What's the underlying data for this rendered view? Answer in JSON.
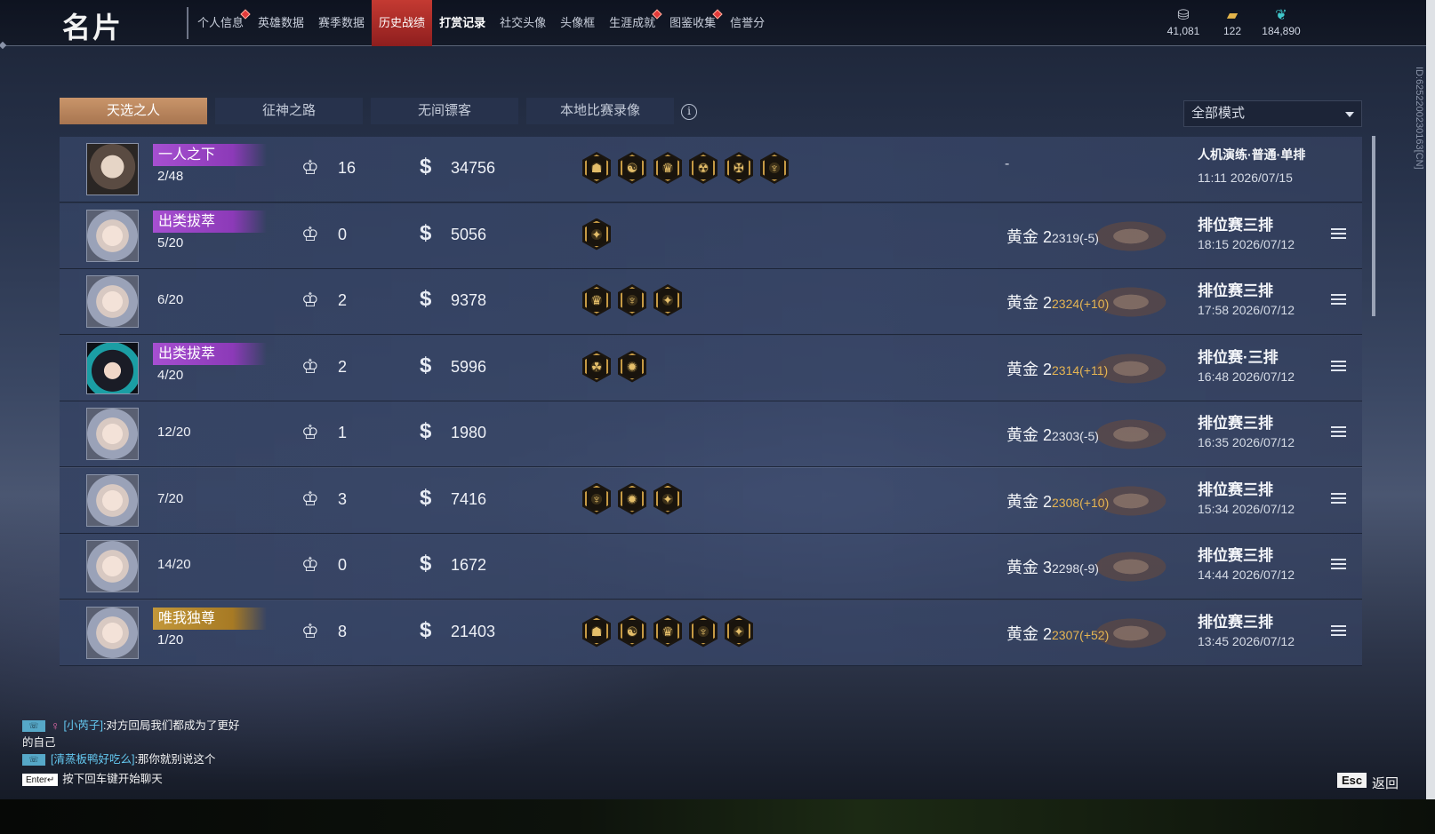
{
  "header": {
    "title": "名片",
    "nav": [
      {
        "label": "个人信息",
        "dot": true
      },
      {
        "label": "英雄数据",
        "dot": false
      },
      {
        "label": "赛季数据",
        "dot": false
      },
      {
        "label": "历史战绩",
        "dot": false,
        "active": true
      },
      {
        "label": "打赏记录",
        "dot": false,
        "bold": true
      },
      {
        "label": "社交头像",
        "dot": false
      },
      {
        "label": "头像框",
        "dot": false
      },
      {
        "label": "生涯成就",
        "dot": true
      },
      {
        "label": "图鉴收集",
        "dot": true
      },
      {
        "label": "信誉分",
        "dot": false
      }
    ],
    "currencies": [
      {
        "icon": "coin-stack-icon",
        "value": "41,081"
      },
      {
        "icon": "gold-ticket-icon",
        "value": "122"
      },
      {
        "icon": "feather-icon",
        "value": "184,890"
      }
    ]
  },
  "side_id": "ID:6252200230163[CN]",
  "mode_tabs": [
    "天选之人",
    "征神之路",
    "无间镖客",
    "本地比赛录像"
  ],
  "mode_select": "全部模式",
  "matches": [
    {
      "avatar": "a1",
      "badge": "一人之下",
      "badge_color": "purple",
      "rank": "2/48",
      "kills": "16",
      "score": "34756",
      "badges": [
        "☗",
        "☯",
        "♛",
        "☢",
        "✠",
        "♆"
      ],
      "tier_name": "",
      "tier_pts": "",
      "tier_dir": "",
      "dash": "-",
      "type": "人机演练·普通·单排",
      "time": "11:11  2026/07/15",
      "detail": false
    },
    {
      "avatar": "a2",
      "badge": "出类拔萃",
      "badge_color": "purple",
      "rank": "5/20",
      "kills": "0",
      "score": "5056",
      "badges": [
        "✦"
      ],
      "tier_name": "黄金 2",
      "tier_pts": "2319(-5)",
      "tier_dir": "down",
      "dash": "",
      "type": "排位赛三排",
      "time": "18:15  2026/07/12",
      "detail": true
    },
    {
      "avatar": "a2",
      "badge": "",
      "badge_color": "",
      "rank": "6/20",
      "kills": "2",
      "score": "9378",
      "badges": [
        "♛",
        "♆",
        "✦"
      ],
      "tier_name": "黄金 2",
      "tier_pts": "2324(+10)",
      "tier_dir": "up",
      "dash": "",
      "type": "排位赛三排",
      "time": "17:58  2026/07/12",
      "detail": true
    },
    {
      "avatar": "a3",
      "badge": "出类拔萃",
      "badge_color": "purple",
      "rank": "4/20",
      "kills": "2",
      "score": "5996",
      "badges": [
        "☘",
        "✹"
      ],
      "tier_name": "黄金 2",
      "tier_pts": "2314(+11)",
      "tier_dir": "up",
      "dash": "",
      "type": "排位赛·三排",
      "time": "16:48  2026/07/12",
      "detail": true
    },
    {
      "avatar": "a2",
      "badge": "",
      "badge_color": "",
      "rank": "12/20",
      "kills": "1",
      "score": "1980",
      "badges": [],
      "tier_name": "黄金 2",
      "tier_pts": "2303(-5)",
      "tier_dir": "down",
      "dash": "",
      "type": "排位赛三排",
      "time": "16:35  2026/07/12",
      "detail": true
    },
    {
      "avatar": "a2",
      "badge": "",
      "badge_color": "",
      "rank": "7/20",
      "kills": "3",
      "score": "7416",
      "badges": [
        "♆",
        "✹",
        "✦"
      ],
      "tier_name": "黄金 2",
      "tier_pts": "2308(+10)",
      "tier_dir": "up",
      "dash": "",
      "type": "排位赛三排",
      "time": "15:34  2026/07/12",
      "detail": true
    },
    {
      "avatar": "a2",
      "badge": "",
      "badge_color": "",
      "rank": "14/20",
      "kills": "0",
      "score": "1672",
      "badges": [],
      "tier_name": "黄金 3",
      "tier_pts": "2298(-9)",
      "tier_dir": "down",
      "dash": "",
      "type": "排位赛三排",
      "time": "14:44  2026/07/12",
      "detail": true
    },
    {
      "avatar": "a2",
      "badge": "唯我独尊",
      "badge_color": "gold",
      "rank": "1/20",
      "kills": "8",
      "score": "21403",
      "badges": [
        "☗",
        "☯",
        "♛",
        "♆",
        "✦"
      ],
      "tier_name": "黄金 2",
      "tier_pts": "2307(+52)",
      "tier_dir": "up",
      "dash": "",
      "type": "排位赛三排",
      "time": "13:45  2026/07/12",
      "detail": true
    }
  ],
  "chat": {
    "messages": [
      {
        "channel": "组队",
        "gender": "♀",
        "name": "[小芮子]",
        "text": ":对方回局我们都成为了更好"
      },
      {
        "channel": "",
        "gender": "",
        "name": "",
        "text": "的自己"
      },
      {
        "channel": "组队",
        "gender": "",
        "name": "[清蒸板鸭好吃么]",
        "text": ":那你就别说这个"
      }
    ],
    "enter_key": "Enter↵",
    "hint": "按下回车键开始聊天"
  },
  "footer": {
    "esc_key": "Esc",
    "back_label": "返回"
  },
  "colors": {
    "accent_red": "#c43a32",
    "tab_active": "#c9956a",
    "gain": "#e6b552",
    "purple_badge": "#a64fd0",
    "gold_badge": "#c2973a"
  }
}
